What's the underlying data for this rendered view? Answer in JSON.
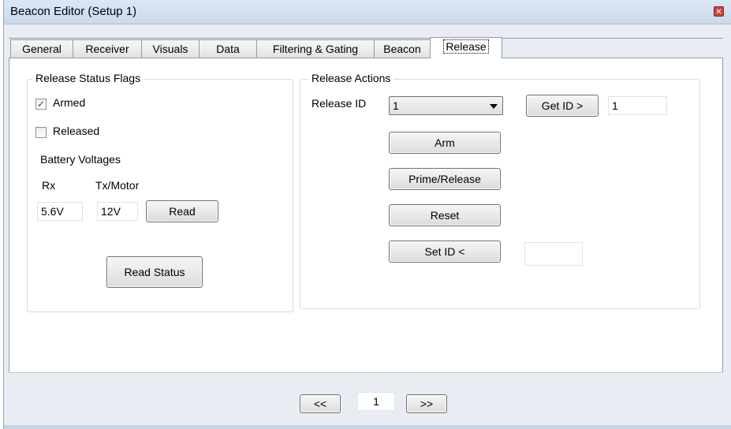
{
  "window": {
    "title": "Beacon Editor (Setup 1)"
  },
  "tabs": [
    {
      "label": "General"
    },
    {
      "label": "Receiver"
    },
    {
      "label": "Visuals"
    },
    {
      "label": "Data"
    },
    {
      "label": "Filtering & Gating"
    },
    {
      "label": "Beacon"
    },
    {
      "label": "Release",
      "active": true
    }
  ],
  "status_group": {
    "title": "Release Status Flags",
    "armed": {
      "label": "Armed",
      "checked": true
    },
    "released": {
      "label": "Released",
      "checked": false
    },
    "battery_heading": "Battery Voltages",
    "rx_label": "Rx",
    "tx_label": "Tx/Motor",
    "rx_value": "5.6V",
    "tx_value": "12V",
    "read_button": "Read",
    "read_status_button": "Read Status"
  },
  "actions_group": {
    "title": "Release Actions",
    "release_id_label": "Release ID",
    "release_id_selected": "1",
    "get_id_button": "Get ID >",
    "get_id_value": "1",
    "arm_button": "Arm",
    "prime_release_button": "Prime/Release",
    "reset_button": "Reset",
    "set_id_button": "Set ID <",
    "set_id_value": ""
  },
  "pager": {
    "prev": "<<",
    "page": "1",
    "next": ">>"
  },
  "colors": {
    "window_bg": "#e9edf3",
    "panel_bg": "#ffffff",
    "title_bar": "#c9d9ec",
    "close_red": "#c9453a"
  }
}
